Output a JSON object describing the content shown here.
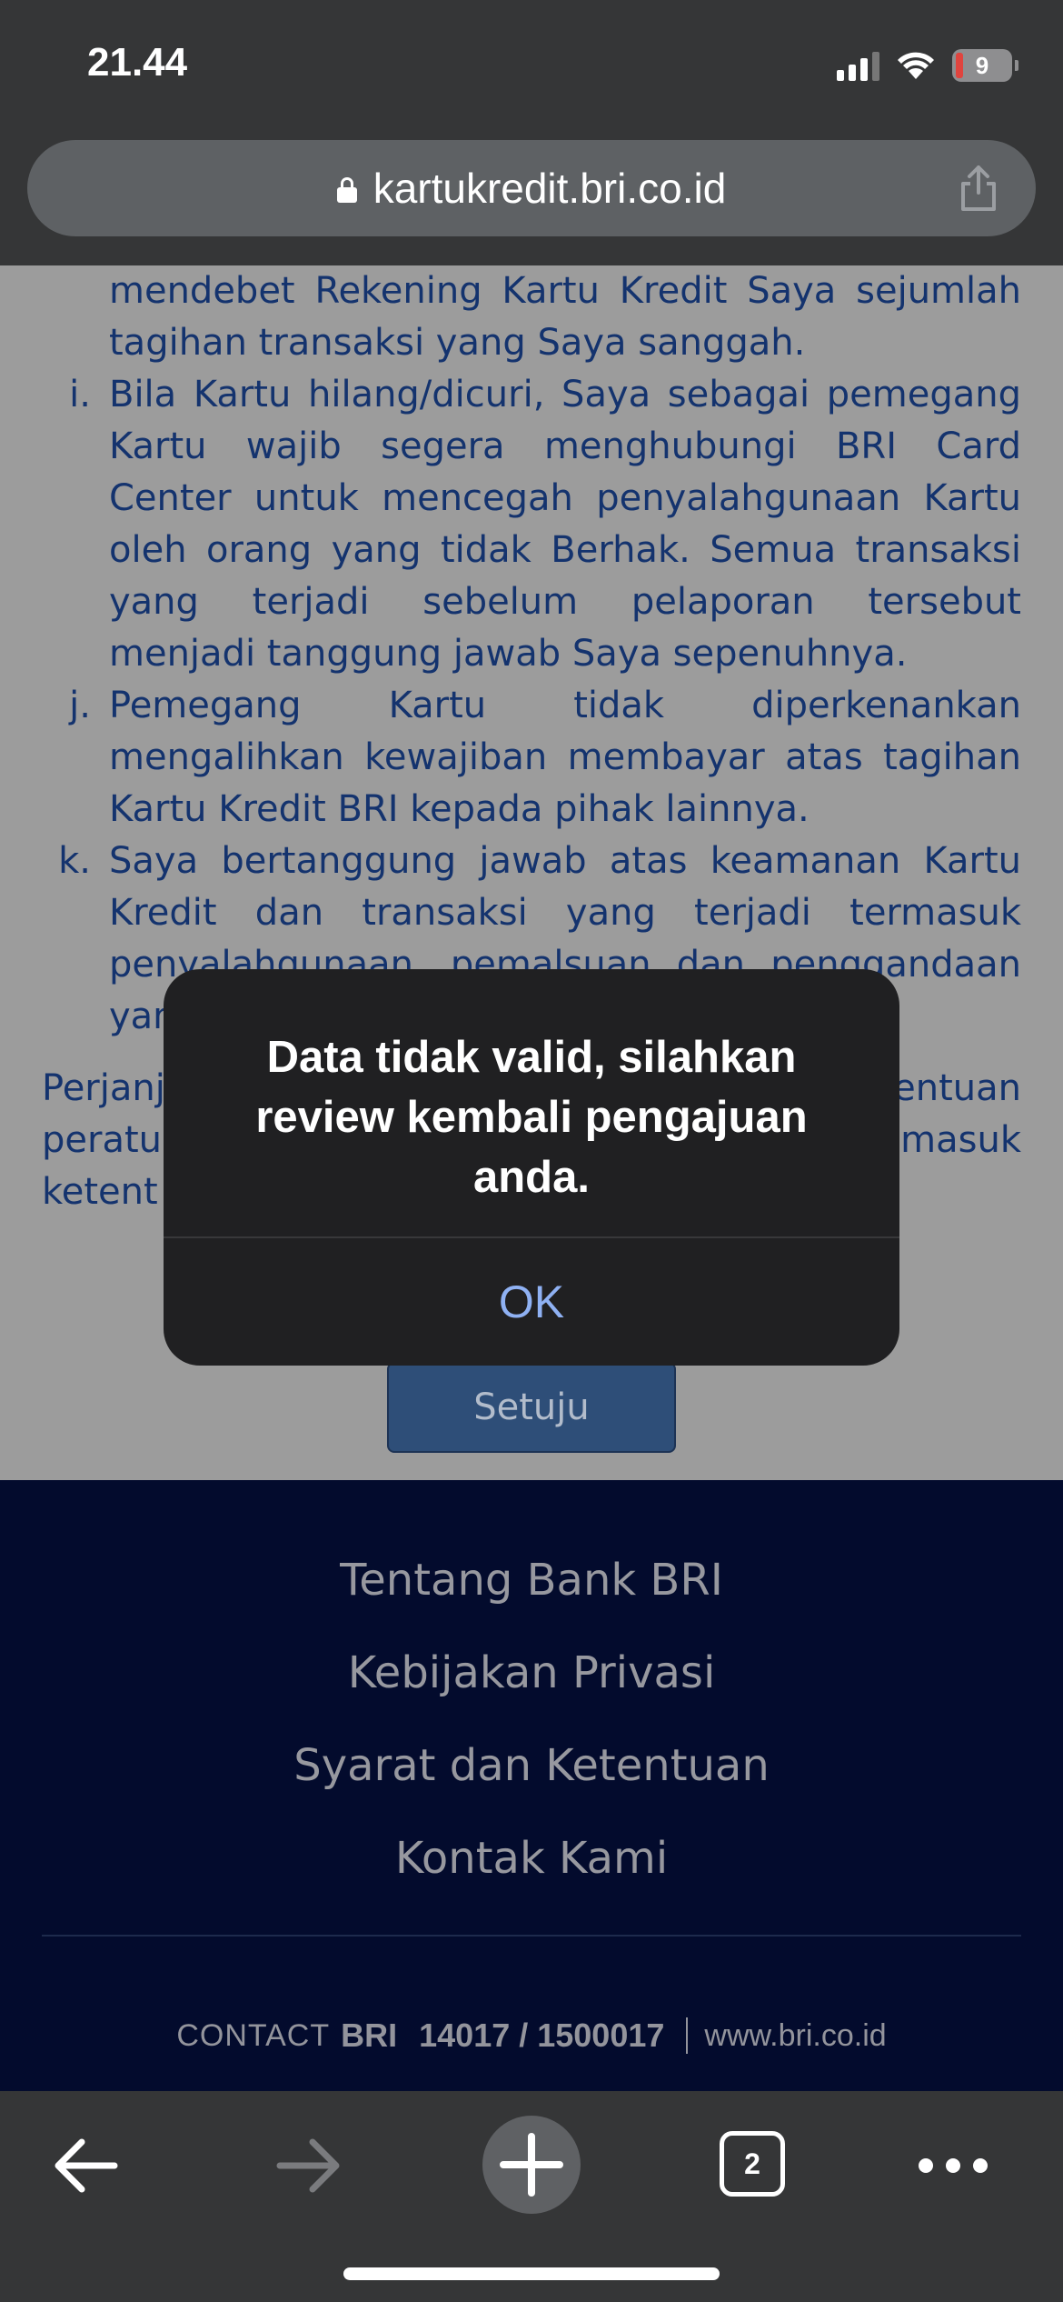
{
  "status_bar": {
    "time": "21.44",
    "battery": "9"
  },
  "browser": {
    "url": "kartukredit.bri.co.id",
    "tab_count": "2"
  },
  "agreement": {
    "top_lines": [
      "mendebet Rekening Kartu Kredit Saya sejumlah",
      "tagihan transaksi yang Saya sanggah."
    ],
    "items": [
      {
        "letter": "i.",
        "lines": [
          "Bila Kartu hilang/dicuri, Saya sebagai pemegang",
          "Kartu wajib segera menghubungi BRI Card",
          "Center untuk mencegah penyalahgunaan Kartu",
          "oleh orang yang tidak Berhak. Semua transaksi",
          "yang terjadi sebelum pelaporan tersebut",
          "menjadi tanggung jawab Saya sepenuhnya."
        ]
      },
      {
        "letter": "j.",
        "lines": [
          "Pemegang Kartu tidak diperkenankan",
          "mengalihkan kewajiban membayar atas tagihan",
          "Kartu Kredit BRI kepada pihak lainnya."
        ]
      },
      {
        "letter": "k.",
        "lines": [
          "Saya bertanggung jawab atas keamanan Kartu",
          "Kredit dan transaksi yang terjadi termasuk",
          "penyalahgunaan, pemalsuan dan penggandaan",
          "yan"
        ]
      }
    ],
    "closing_lines": [
      {
        "left": "Perjanj",
        "right": "entuan"
      },
      {
        "left": "peratu",
        "right": "masuk"
      },
      {
        "left": "ketent",
        "right": ""
      }
    ],
    "agree_button": "Setuju"
  },
  "footer": {
    "links": [
      "Tentang Bank BRI",
      "Kebijakan Privasi",
      "Syarat dan Ketentuan",
      "Kontak Kami"
    ],
    "contact_label": "CONTACT",
    "contact_brand": "BRI",
    "contact_numbers": "14017 / 1500017",
    "website": "www.bri.co.id"
  },
  "alert": {
    "message": "Data tidak valid, silahkan review kembali pengajuan anda.",
    "ok_label": "OK"
  },
  "colors": {
    "link_text": "#14336e",
    "alert_ok": "#8fb1f3",
    "footer_bg": "#030b2d"
  }
}
